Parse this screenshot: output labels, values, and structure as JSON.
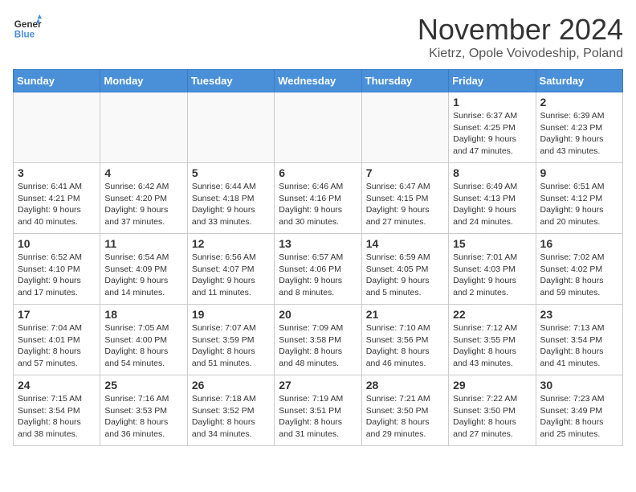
{
  "header": {
    "logo_line1": "General",
    "logo_line2": "Blue",
    "month_title": "November 2024",
    "location": "Kietrz, Opole Voivodeship, Poland"
  },
  "weekdays": [
    "Sunday",
    "Monday",
    "Tuesday",
    "Wednesday",
    "Thursday",
    "Friday",
    "Saturday"
  ],
  "weeks": [
    [
      {
        "day": "",
        "detail": ""
      },
      {
        "day": "",
        "detail": ""
      },
      {
        "day": "",
        "detail": ""
      },
      {
        "day": "",
        "detail": ""
      },
      {
        "day": "",
        "detail": ""
      },
      {
        "day": "1",
        "detail": "Sunrise: 6:37 AM\nSunset: 4:25 PM\nDaylight: 9 hours and 47 minutes."
      },
      {
        "day": "2",
        "detail": "Sunrise: 6:39 AM\nSunset: 4:23 PM\nDaylight: 9 hours and 43 minutes."
      }
    ],
    [
      {
        "day": "3",
        "detail": "Sunrise: 6:41 AM\nSunset: 4:21 PM\nDaylight: 9 hours and 40 minutes."
      },
      {
        "day": "4",
        "detail": "Sunrise: 6:42 AM\nSunset: 4:20 PM\nDaylight: 9 hours and 37 minutes."
      },
      {
        "day": "5",
        "detail": "Sunrise: 6:44 AM\nSunset: 4:18 PM\nDaylight: 9 hours and 33 minutes."
      },
      {
        "day": "6",
        "detail": "Sunrise: 6:46 AM\nSunset: 4:16 PM\nDaylight: 9 hours and 30 minutes."
      },
      {
        "day": "7",
        "detail": "Sunrise: 6:47 AM\nSunset: 4:15 PM\nDaylight: 9 hours and 27 minutes."
      },
      {
        "day": "8",
        "detail": "Sunrise: 6:49 AM\nSunset: 4:13 PM\nDaylight: 9 hours and 24 minutes."
      },
      {
        "day": "9",
        "detail": "Sunrise: 6:51 AM\nSunset: 4:12 PM\nDaylight: 9 hours and 20 minutes."
      }
    ],
    [
      {
        "day": "10",
        "detail": "Sunrise: 6:52 AM\nSunset: 4:10 PM\nDaylight: 9 hours and 17 minutes."
      },
      {
        "day": "11",
        "detail": "Sunrise: 6:54 AM\nSunset: 4:09 PM\nDaylight: 9 hours and 14 minutes."
      },
      {
        "day": "12",
        "detail": "Sunrise: 6:56 AM\nSunset: 4:07 PM\nDaylight: 9 hours and 11 minutes."
      },
      {
        "day": "13",
        "detail": "Sunrise: 6:57 AM\nSunset: 4:06 PM\nDaylight: 9 hours and 8 minutes."
      },
      {
        "day": "14",
        "detail": "Sunrise: 6:59 AM\nSunset: 4:05 PM\nDaylight: 9 hours and 5 minutes."
      },
      {
        "day": "15",
        "detail": "Sunrise: 7:01 AM\nSunset: 4:03 PM\nDaylight: 9 hours and 2 minutes."
      },
      {
        "day": "16",
        "detail": "Sunrise: 7:02 AM\nSunset: 4:02 PM\nDaylight: 8 hours and 59 minutes."
      }
    ],
    [
      {
        "day": "17",
        "detail": "Sunrise: 7:04 AM\nSunset: 4:01 PM\nDaylight: 8 hours and 57 minutes."
      },
      {
        "day": "18",
        "detail": "Sunrise: 7:05 AM\nSunset: 4:00 PM\nDaylight: 8 hours and 54 minutes."
      },
      {
        "day": "19",
        "detail": "Sunrise: 7:07 AM\nSunset: 3:59 PM\nDaylight: 8 hours and 51 minutes."
      },
      {
        "day": "20",
        "detail": "Sunrise: 7:09 AM\nSunset: 3:58 PM\nDaylight: 8 hours and 48 minutes."
      },
      {
        "day": "21",
        "detail": "Sunrise: 7:10 AM\nSunset: 3:56 PM\nDaylight: 8 hours and 46 minutes."
      },
      {
        "day": "22",
        "detail": "Sunrise: 7:12 AM\nSunset: 3:55 PM\nDaylight: 8 hours and 43 minutes."
      },
      {
        "day": "23",
        "detail": "Sunrise: 7:13 AM\nSunset: 3:54 PM\nDaylight: 8 hours and 41 minutes."
      }
    ],
    [
      {
        "day": "24",
        "detail": "Sunrise: 7:15 AM\nSunset: 3:54 PM\nDaylight: 8 hours and 38 minutes."
      },
      {
        "day": "25",
        "detail": "Sunrise: 7:16 AM\nSunset: 3:53 PM\nDaylight: 8 hours and 36 minutes."
      },
      {
        "day": "26",
        "detail": "Sunrise: 7:18 AM\nSunset: 3:52 PM\nDaylight: 8 hours and 34 minutes."
      },
      {
        "day": "27",
        "detail": "Sunrise: 7:19 AM\nSunset: 3:51 PM\nDaylight: 8 hours and 31 minutes."
      },
      {
        "day": "28",
        "detail": "Sunrise: 7:21 AM\nSunset: 3:50 PM\nDaylight: 8 hours and 29 minutes."
      },
      {
        "day": "29",
        "detail": "Sunrise: 7:22 AM\nSunset: 3:50 PM\nDaylight: 8 hours and 27 minutes."
      },
      {
        "day": "30",
        "detail": "Sunrise: 7:23 AM\nSunset: 3:49 PM\nDaylight: 8 hours and 25 minutes."
      }
    ]
  ]
}
